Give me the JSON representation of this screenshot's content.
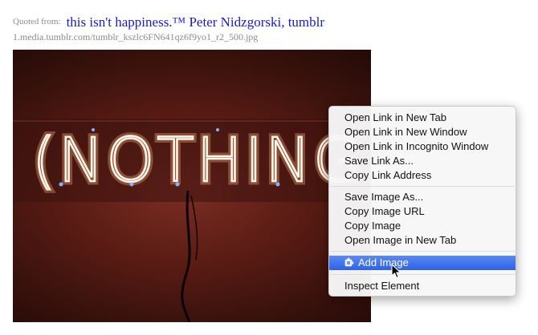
{
  "citation": {
    "prefix": "Quoted from:",
    "title": "this isn't happiness.™ Peter Nidzgorski, tumblr",
    "image_url": "1.media.tumblr.com/tumblr_kszlc6FN641qz6f9yo1_r2_500.jpg"
  },
  "photo": {
    "neon_text": "(NOTHING"
  },
  "context_menu": {
    "link_items": [
      {
        "label": "Open Link in New Tab"
      },
      {
        "label": "Open Link in New Window"
      },
      {
        "label": "Open Link in Incognito Window"
      },
      {
        "label": "Save Link As..."
      },
      {
        "label": "Copy Link Address"
      }
    ],
    "image_items": [
      {
        "label": "Save Image As..."
      },
      {
        "label": "Copy Image URL"
      },
      {
        "label": "Copy Image"
      },
      {
        "label": "Open Image in New Tab"
      }
    ],
    "extension_item": {
      "label": "Add Image",
      "icon": "puzzle-icon",
      "highlighted": true
    },
    "inspect_item": {
      "label": "Inspect Element"
    }
  },
  "colors": {
    "link": "#1a1ad0",
    "highlight": "#2d62e8",
    "muted_text": "#8a8a8a"
  }
}
